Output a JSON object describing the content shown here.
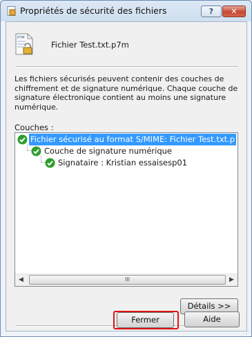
{
  "window": {
    "title": "Propriétés de sécurité des fichiers",
    "help_button": "?",
    "close_button": "✕"
  },
  "file": {
    "icon_label": "P7M",
    "name": "Fichier Test.txt.p7m"
  },
  "description": "Les fichiers sécurisés peuvent contenir des couches de chiffrement et de signature numérique. Chaque couche de signature électronique contient au moins une signature numérique.",
  "layers": {
    "label": "Couches :",
    "nodes": [
      {
        "label": "Fichier sécurisé au format S/MIME: Fichier Test.txt.p",
        "selected": true,
        "status": "valid"
      },
      {
        "label": "Couche de signature numérique",
        "selected": false,
        "status": "valid"
      },
      {
        "label": "Signataire : Kristian essaisesp01",
        "selected": false,
        "status": "valid"
      }
    ]
  },
  "scrollbar": {
    "left_arrow": "◀",
    "right_arrow": "▶",
    "grip": "III"
  },
  "buttons": {
    "details": "Détails >>",
    "close": "Fermer",
    "help": "Aide"
  },
  "colors": {
    "selection": "#3399ff",
    "highlight_border": "#e01010",
    "status_valid": "#2e9e2e"
  }
}
